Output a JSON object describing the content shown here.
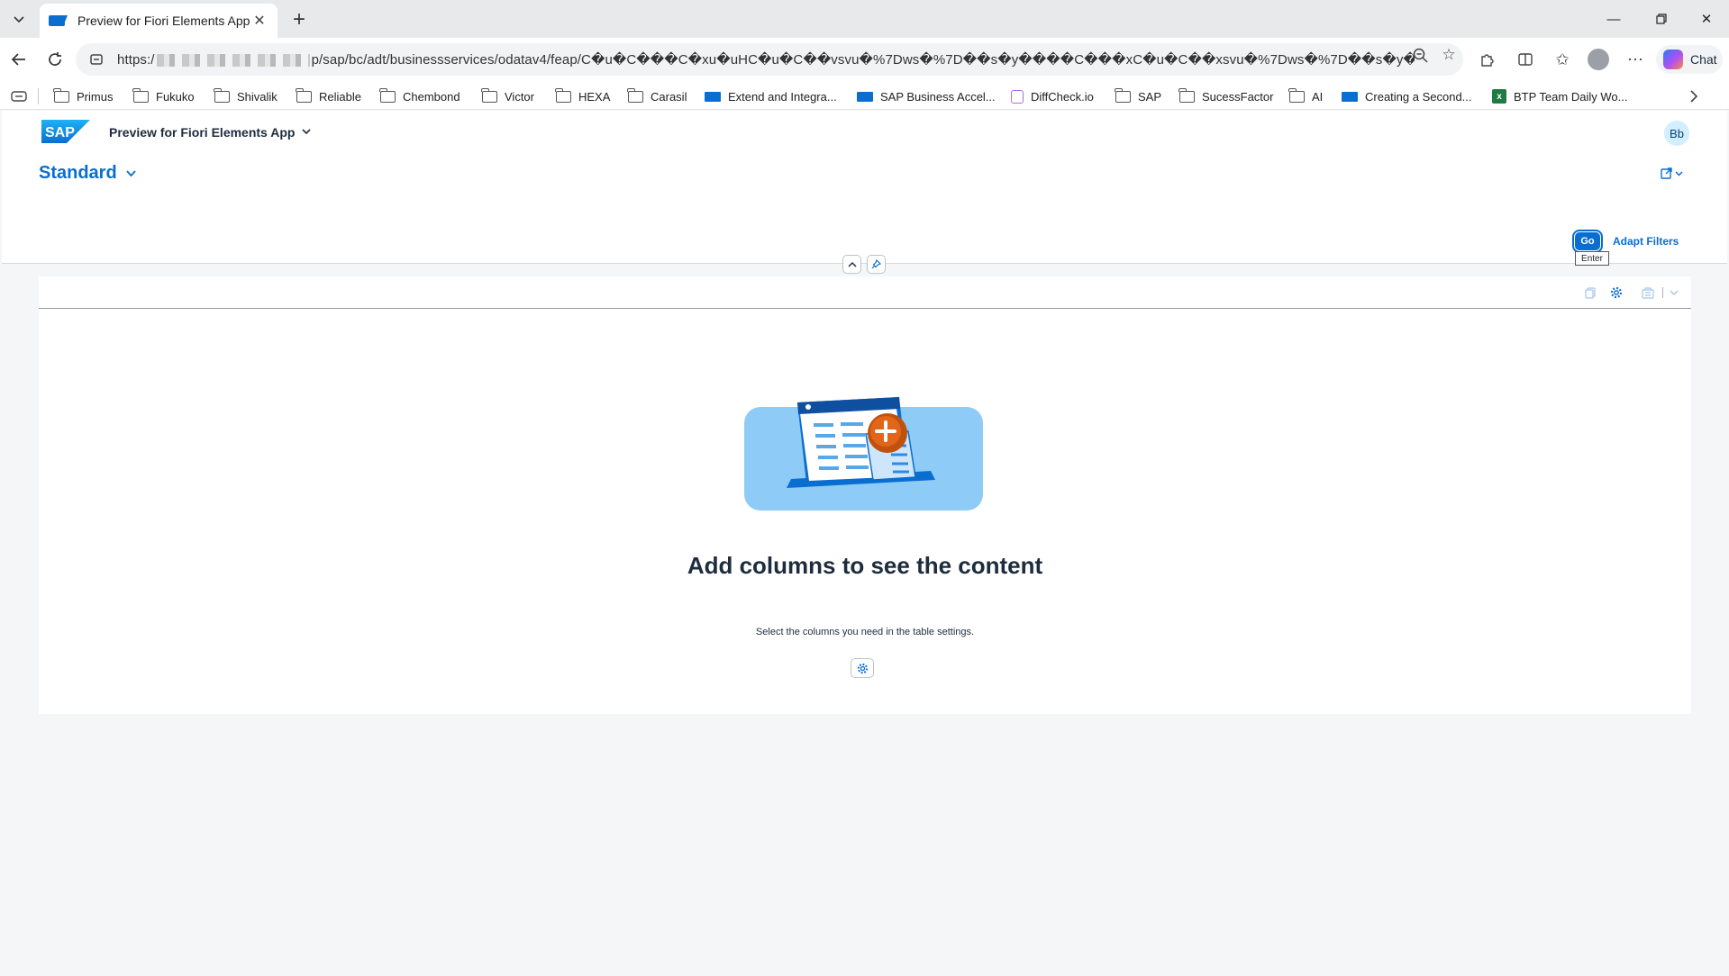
{
  "browser": {
    "tab_title": "Preview for Fiori Elements App",
    "new_tab": "+",
    "url_prefix": "https:/",
    "url_suffix": "p/sap/bc/adt/businessservices/odatav4/feap/C�u�C���C�xu�uHC�u�C��vsvu�%7Dws�%7D��s�y����C���xC�u�C��xsvu�%7Dws�%7D��s�y�...",
    "chat_label": "Chat"
  },
  "bookmarks": [
    {
      "label": "Primus",
      "icon": "folder-icon"
    },
    {
      "label": "Fukuko",
      "icon": "folder-icon"
    },
    {
      "label": "Shivalik",
      "icon": "folder-icon"
    },
    {
      "label": "Reliable",
      "icon": "folder-icon"
    },
    {
      "label": "Chembond",
      "icon": "folder-icon"
    },
    {
      "label": "Victor",
      "icon": "folder-icon"
    },
    {
      "label": "HEXA",
      "icon": "folder-icon"
    },
    {
      "label": "Carasil",
      "icon": "folder-icon"
    },
    {
      "label": "Extend and Integra...",
      "icon": "sap-icon"
    },
    {
      "label": "SAP Business Accel...",
      "icon": "sap-icon"
    },
    {
      "label": "DiffCheck.io",
      "icon": "diffcheck-icon"
    },
    {
      "label": "SAP",
      "icon": "folder-icon"
    },
    {
      "label": "SucessFactor",
      "icon": "folder-icon"
    },
    {
      "label": "AI",
      "icon": "folder-icon"
    },
    {
      "label": "Creating a Second...",
      "icon": "sap-icon"
    },
    {
      "label": "BTP Team Daily Wo...",
      "icon": "excel-icon"
    }
  ],
  "shell": {
    "logo_text": "SAP",
    "app_title": "Preview for Fiori Elements App",
    "user_initials": "Bb"
  },
  "filter_bar": {
    "variant": "Standard",
    "go_label": "Go",
    "go_tooltip": "Enter",
    "adapt_filters": "Adapt Filters"
  },
  "table": {
    "empty_title": "Add columns to see the content",
    "empty_description": "Select the columns you need in the table settings."
  },
  "colors": {
    "accent": "#0a6ed1",
    "illustration_bg": "#8ecbf6",
    "plus_badge": "#c0510e"
  }
}
